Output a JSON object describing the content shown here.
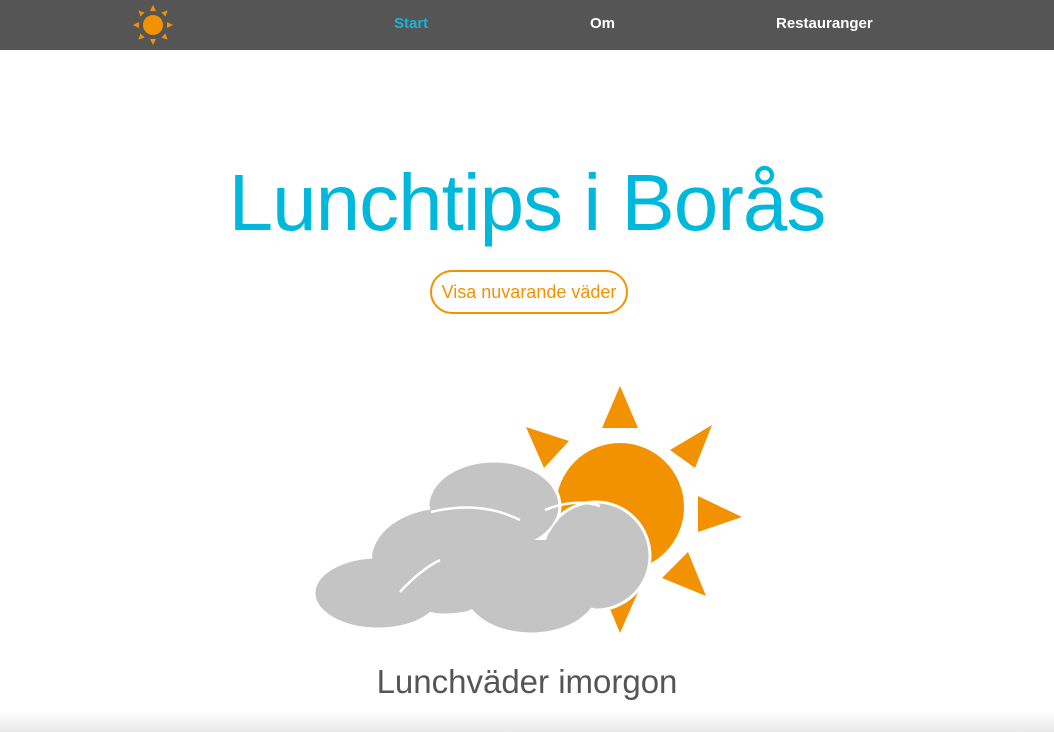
{
  "nav": {
    "logo_icon": "sun-icon",
    "links": [
      {
        "label": "Start",
        "active": true
      },
      {
        "label": "Om",
        "active": false
      },
      {
        "label": "Restauranger",
        "active": false
      }
    ]
  },
  "hero": {
    "title": "Lunchtips i Borås",
    "button_label": "Visa nuvarande väder"
  },
  "weather": {
    "icon": "partly-cloudy-icon",
    "heading": "Lunchväder imorgon"
  },
  "colors": {
    "nav_background": "#555555",
    "accent_blue": "#00b7dc",
    "accent_orange": "#f39200",
    "cloud_gray": "#c4c4c4"
  }
}
